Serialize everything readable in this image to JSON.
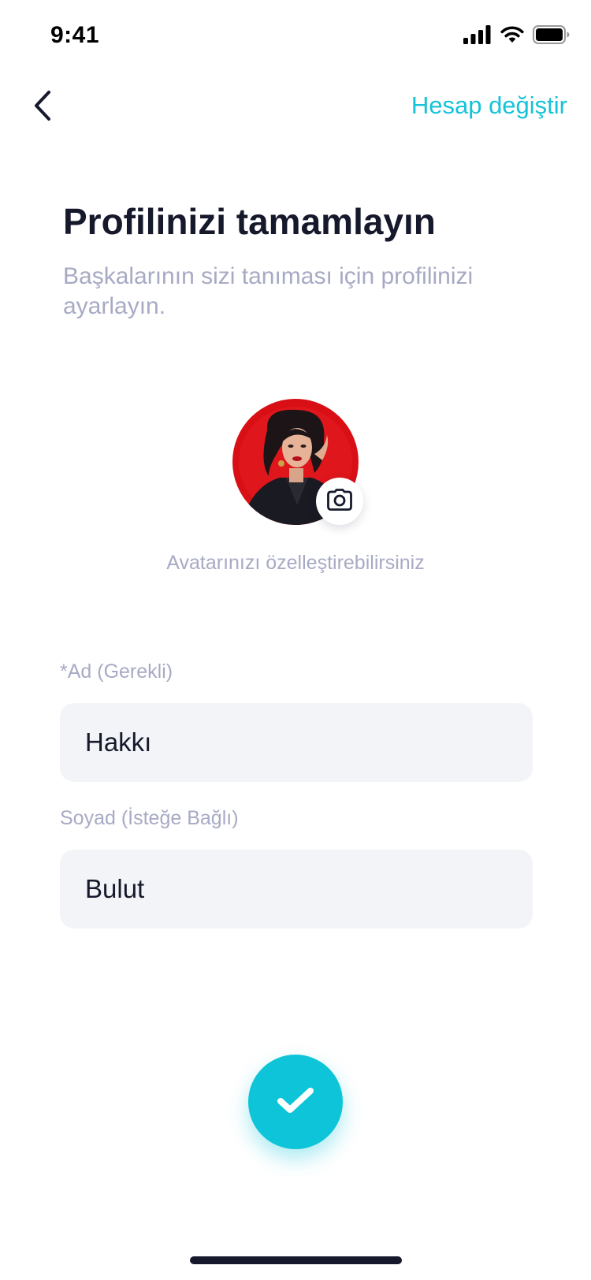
{
  "status_bar": {
    "time": "9:41",
    "signal_icon": "cellular-signal-icon",
    "wifi_icon": "wifi-icon",
    "battery_icon": "battery-icon"
  },
  "nav": {
    "back_icon": "chevron-left-icon",
    "switch_account_label": "Hesap değiştir"
  },
  "header": {
    "title": "Profilinizi tamamlayın",
    "subtitle": "Başkalarının sizi tanıması için profilinizi ayarlayın."
  },
  "avatar": {
    "camera_icon": "camera-icon",
    "hint": "Avatarınızı özelleştirebilirsiniz"
  },
  "form": {
    "first_name": {
      "label": "*Ad (Gerekli)",
      "value": "Hakkı"
    },
    "last_name": {
      "label": "Soyad (İsteğe Bağlı)",
      "value": "Bulut"
    }
  },
  "confirm": {
    "icon": "checkmark-icon"
  },
  "colors": {
    "accent": "#0ec4d9",
    "text_primary": "#15192b",
    "text_secondary": "#a7aac4",
    "field_background": "#f3f4f8"
  }
}
